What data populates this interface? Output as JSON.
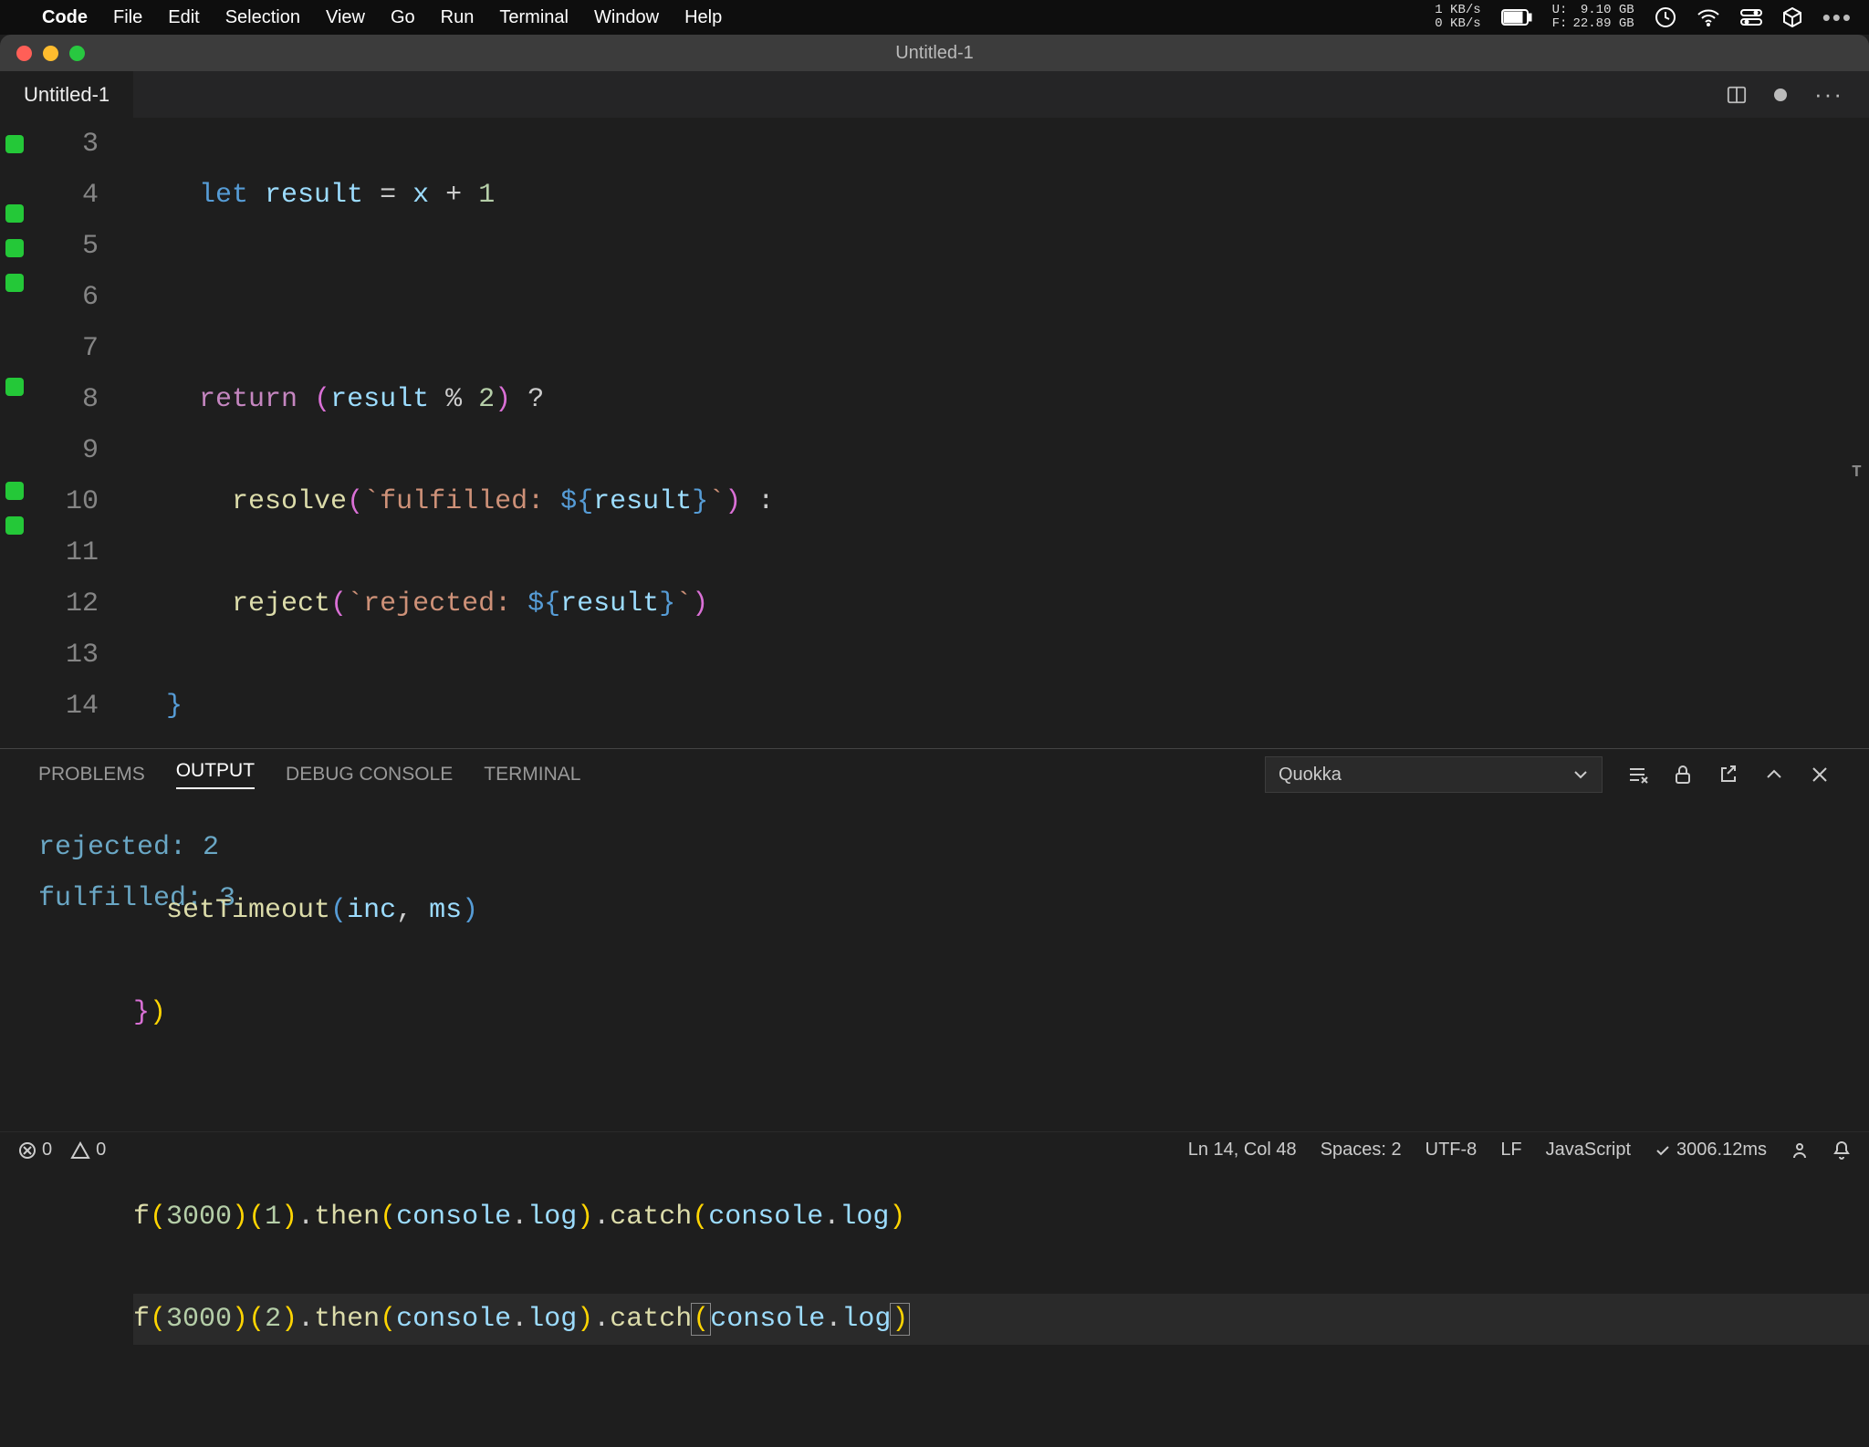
{
  "menubar": {
    "app": "Code",
    "items": [
      "File",
      "Edit",
      "Selection",
      "View",
      "Go",
      "Run",
      "Terminal",
      "Window",
      "Help"
    ],
    "net_up": "1 KB/s",
    "net_down": "0 KB/s",
    "disk_u_label": "U:",
    "disk_f_label": "F:",
    "disk_u": "9.10 GB",
    "disk_f": "22.89 GB"
  },
  "window": {
    "title": "Untitled-1"
  },
  "tabs": [
    {
      "title": "Untitled-1",
      "modified": true
    }
  ],
  "editor": {
    "lines": [
      {
        "n": 3,
        "square": true
      },
      {
        "n": 4,
        "square": false
      },
      {
        "n": 5,
        "square": true
      },
      {
        "n": 6,
        "square": true
      },
      {
        "n": 7,
        "square": true
      },
      {
        "n": 8,
        "square": false
      },
      {
        "n": 9,
        "square": false
      },
      {
        "n": 10,
        "square": true
      },
      {
        "n": 11,
        "square": false
      },
      {
        "n": 12,
        "square": false
      },
      {
        "n": 13,
        "square": true
      },
      {
        "n": 14,
        "square": true
      }
    ],
    "tok": {
      "let": "let",
      "result": "result",
      "eq": "=",
      "x": "x",
      "plus": "+",
      "one": "1",
      "return": "return",
      "mod": "%",
      "two": "2",
      "q": "?",
      "resolve": "resolve",
      "fulfilled": "fulfilled: ",
      "colon": ":",
      "reject": "reject",
      "rejected": "rejected: ",
      "setTimeout": "setTimeout",
      "inc": "inc",
      "comma": ",",
      "ms": "ms",
      "f": "f",
      "v3000": "3000",
      "v1": "1",
      "v2": "2",
      "then": "then",
      "catch": "catch",
      "console": "console",
      "log": "log",
      "dot": ".",
      "op": "(",
      "cp": ")",
      "ob": "{",
      "cb": "}",
      "bt": "`",
      "dollar": "$"
    }
  },
  "panel": {
    "tabs": [
      "PROBLEMS",
      "OUTPUT",
      "DEBUG CONSOLE",
      "TERMINAL"
    ],
    "active": "OUTPUT",
    "channel": "Quokka",
    "lines": [
      "rejected: 2",
      "",
      "fulfilled: 3"
    ]
  },
  "statusbar": {
    "errors": "0",
    "warnings": "0",
    "cursor": "Ln 14, Col 48",
    "spaces": "Spaces: 2",
    "encoding": "UTF-8",
    "eol": "LF",
    "language": "JavaScript",
    "quokka": "3006.12ms"
  }
}
